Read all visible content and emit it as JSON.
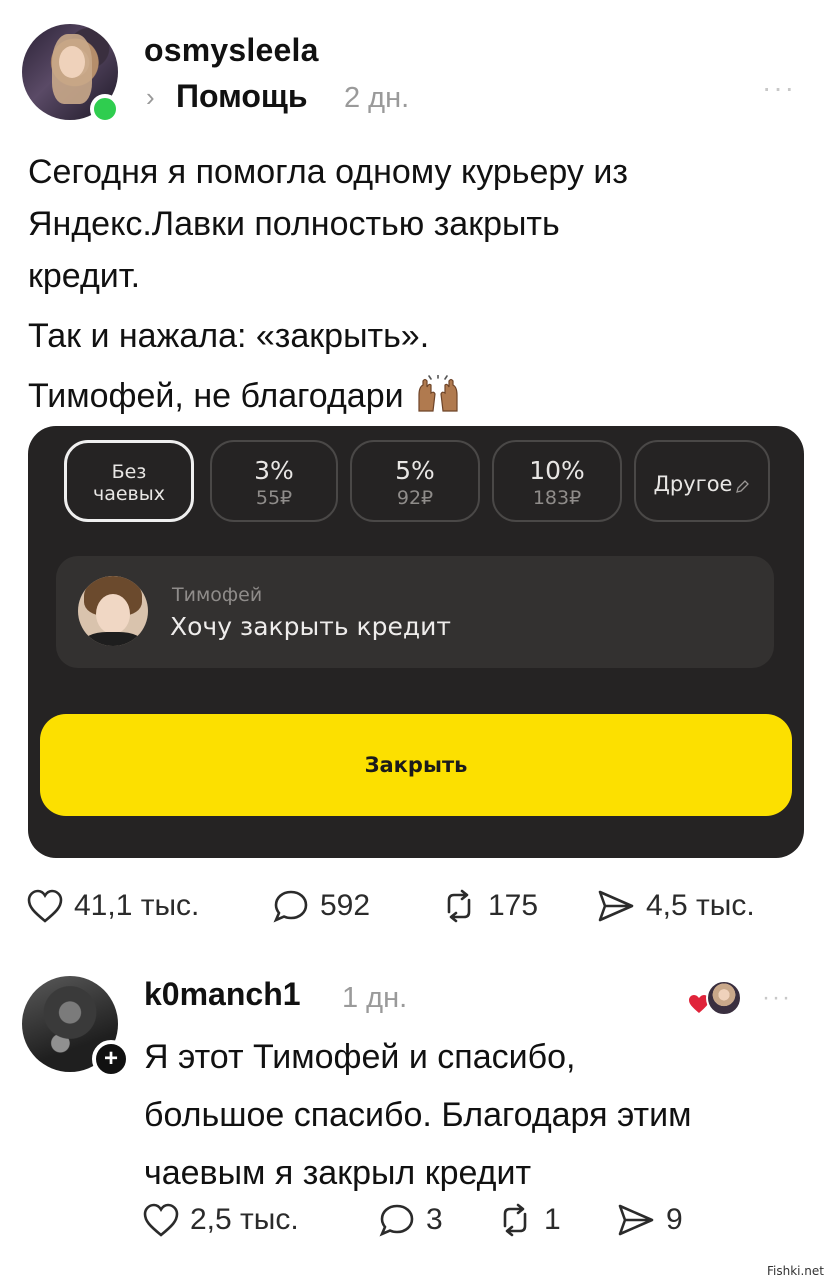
{
  "post": {
    "username": "osmysleela",
    "community_chevron": "›",
    "community": "Помощь",
    "time": "2 дн.",
    "more": "···",
    "text_lines": [
      "Сегодня я помогла одному курьеру из",
      "Яндекс.Лавки полностью закрыть",
      "кредит."
    ],
    "text_line2": "Так и нажала: «закрыть».",
    "text_line3": "Тимофей, не благодари",
    "emoji": "raising-hands"
  },
  "tip_card": {
    "options": [
      {
        "line1": "Без",
        "line2": "чаевых",
        "selected": true
      },
      {
        "line1": "3%",
        "line2": "55₽"
      },
      {
        "line1": "5%",
        "line2": "92₽"
      },
      {
        "line1": "10%",
        "line2": "183₽"
      },
      {
        "line1": "Другое",
        "line2": ""
      }
    ],
    "message_author": "Тимофей",
    "message_text": "Хочу закрыть кредит",
    "button_label": "Закрыть",
    "colors": {
      "background": "#252323",
      "button": "#fce000"
    }
  },
  "post_stats": {
    "likes": "41,1 тыс.",
    "comments": "592",
    "reposts": "175",
    "shares": "4,5 тыс."
  },
  "reply": {
    "username": "k0manch1",
    "time": "1 дн.",
    "more": "···",
    "text_lines": [
      "Я этот Тимофей и спасибо,",
      "большое спасибо. Благодаря этим",
      "чаевым я закрыл кредит"
    ],
    "plus": "+",
    "stats": {
      "likes": "2,5 тыс.",
      "comments": "3",
      "reposts": "1",
      "shares": "9"
    }
  },
  "watermark": "Fishki.net"
}
